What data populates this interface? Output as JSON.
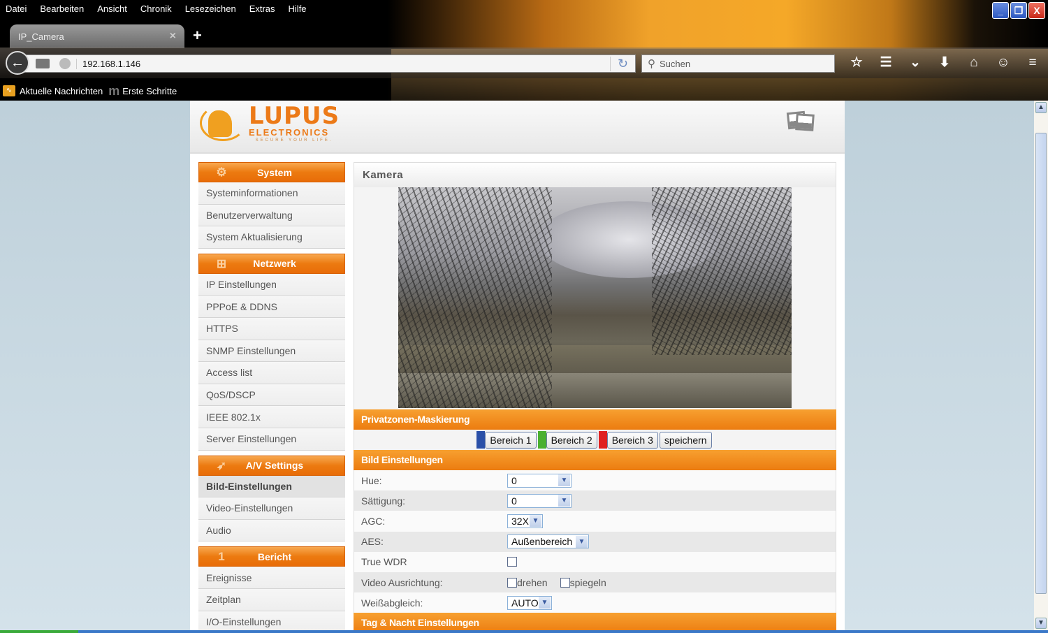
{
  "browser": {
    "menu": [
      "Datei",
      "Bearbeiten",
      "Ansicht",
      "Chronik",
      "Lesezeichen",
      "Extras",
      "Hilfe"
    ],
    "tab_title": "IP_Camera",
    "tab_close": "×",
    "new_tab": "+",
    "url": "192.168.1.146",
    "search_placeholder": "Suchen",
    "bookmarks": [
      "Aktuelle Nachrichten",
      "Erste Schritte"
    ],
    "window_buttons": {
      "minimize": "_",
      "maximize": "❐",
      "close": "X"
    },
    "toolbar_icons": {
      "bookmark": "☆",
      "reading_list": "☰",
      "pocket": "⌄",
      "downloads": "⬇",
      "home": "⌂",
      "chat": "☺",
      "menu": "≡"
    }
  },
  "header": {
    "brand": "LUPUS",
    "brand_sub": "ELECTRONICS",
    "tagline": "SECURE YOUR LIFE."
  },
  "sidebar": {
    "sections": [
      {
        "title": "System",
        "icon": "⚙",
        "items": [
          "Systeminformationen",
          "Benutzerverwaltung",
          "System Aktualisierung"
        ]
      },
      {
        "title": "Netzwerk",
        "icon": "⊞",
        "items": [
          "IP Einstellungen",
          "PPPoE & DDNS",
          "HTTPS",
          "SNMP Einstellungen",
          "Access list",
          "QoS/DSCP",
          "IEEE 802.1x",
          "Server Einstellungen"
        ]
      },
      {
        "title": "A/V Settings",
        "icon": "➶",
        "items": [
          "Bild-Einstellungen",
          "Video-Einstellungen",
          "Audio"
        ]
      },
      {
        "title": "Bericht",
        "icon": "1",
        "items": [
          "Ereignisse",
          "Zeitplan",
          "I/O-Einstellungen"
        ]
      }
    ],
    "active_item": "Bild-Einstellungen"
  },
  "main": {
    "panel_title": "Kamera",
    "privacy": {
      "title": "Privatzonen-Maskierung",
      "buttons": [
        {
          "label": "Bereich 1",
          "color": "#2a50a8"
        },
        {
          "label": "Bereich 2",
          "color": "#4ab030"
        },
        {
          "label": "Bereich 3",
          "color": "#e02020"
        }
      ],
      "save_label": "speichern"
    },
    "image_settings": {
      "title": "Bild Einstellungen",
      "hue": {
        "label": "Hue:",
        "value": "0"
      },
      "saturation": {
        "label": "Sättigung:",
        "value": "0"
      },
      "agc": {
        "label": "AGC:",
        "value": "32X"
      },
      "aes": {
        "label": "AES:",
        "value": "Außenbereich"
      },
      "wdr": {
        "label": "True WDR",
        "checked": false
      },
      "orientation": {
        "label": "Video Ausrichtung:",
        "options": [
          {
            "label": "drehen",
            "checked": false
          },
          {
            "label": "spiegeln",
            "checked": false
          }
        ]
      },
      "white_balance": {
        "label": "Weißabgleich:",
        "value": "AUTO"
      }
    },
    "day_night": {
      "title": "Tag & Nacht Einstellungen"
    }
  },
  "colors": {
    "accent_orange": "#ec7c10",
    "window_bg": "#c8d8e0"
  }
}
